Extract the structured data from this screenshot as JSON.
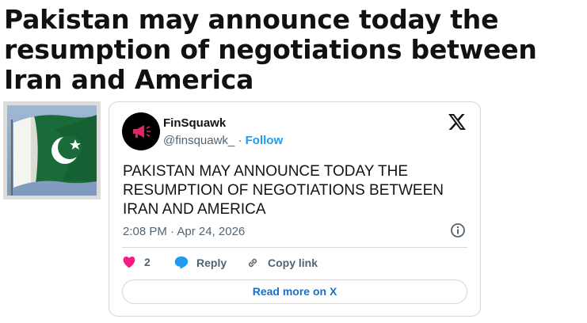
{
  "article": {
    "headline": "Pakistan may announce today the resumption of negotiations between Iran and America"
  },
  "tweet": {
    "author_name": "FinSquawk",
    "handle": "@finsquawk_",
    "separator": " · ",
    "follow_label": "Follow",
    "text": "PAKISTAN MAY ANNOUNCE TODAY THE RESUMPTION OF NEGOTIATIONS BETWEEN IRAN AND AMERICA",
    "timestamp": "2:08 PM · Apr 24, 2026",
    "like_count": "2",
    "reply_label": "Reply",
    "copy_link_label": "Copy link",
    "read_more_label": "Read more on X"
  },
  "icons": {
    "avatar": "megaphone-icon",
    "brand": "x-logo-icon",
    "info": "info-icon",
    "like": "heart-icon",
    "reply": "speech-bubble-icon",
    "copy": "link-icon"
  },
  "colors": {
    "link_blue": "#1d9bf0",
    "heart": "#f91880",
    "flag_green": "#1a6b3a",
    "avatar_red": "#e0245e"
  }
}
